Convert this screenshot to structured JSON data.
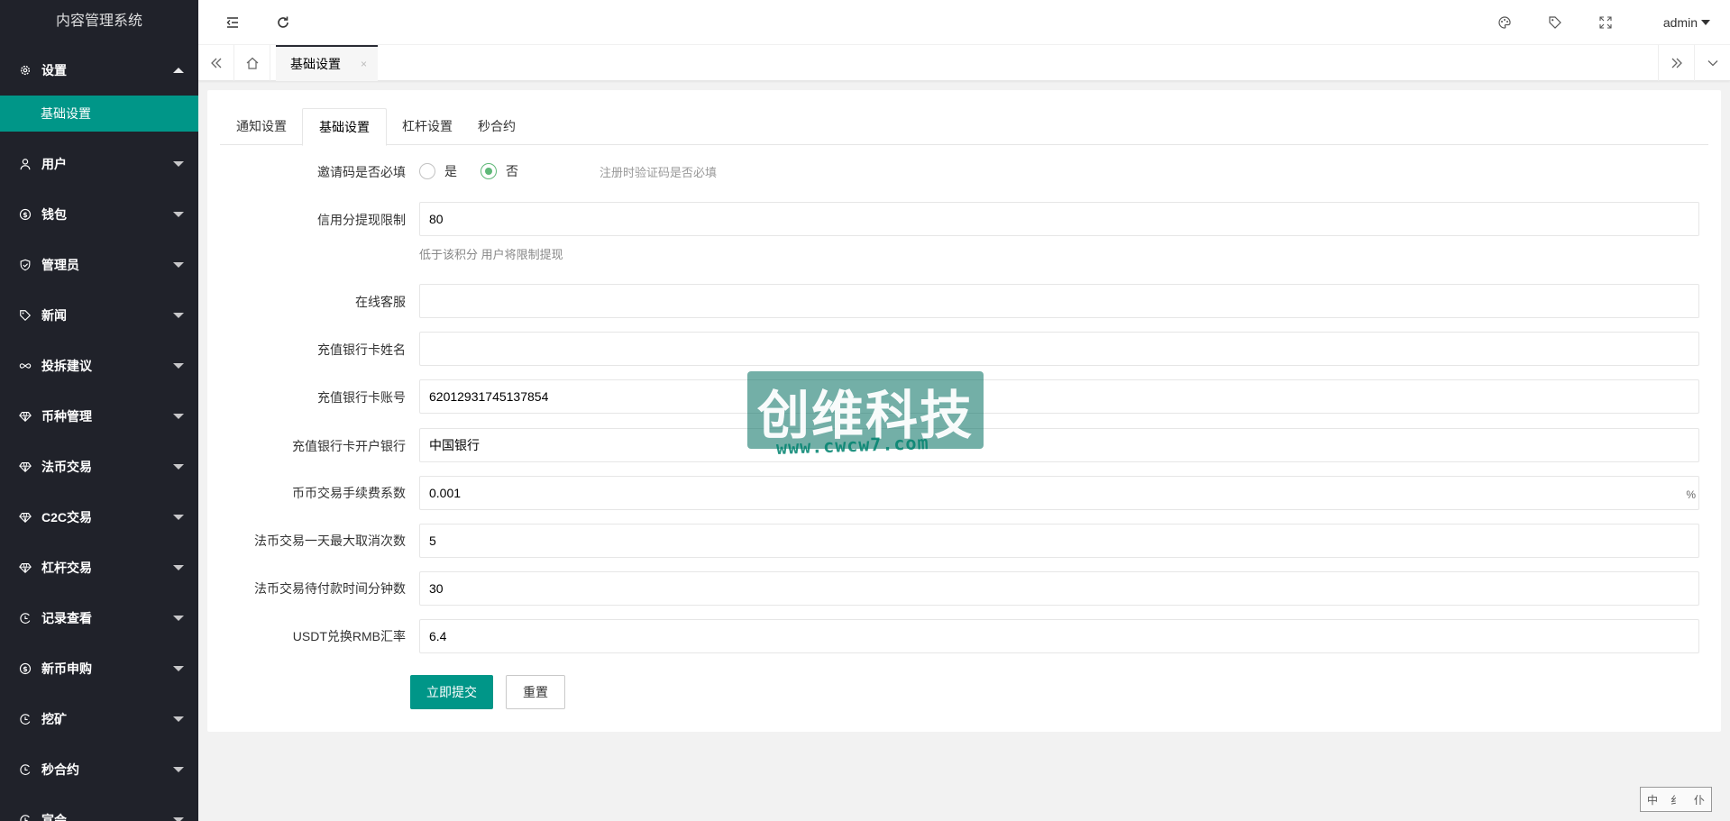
{
  "sidebar": {
    "title": "内容管理系统",
    "items": [
      {
        "label": "设置",
        "icon": "gear-icon",
        "expanded": true
      },
      {
        "label": "用户",
        "icon": "user-icon"
      },
      {
        "label": "钱包",
        "icon": "coin-icon"
      },
      {
        "label": "管理员",
        "icon": "shield-icon"
      },
      {
        "label": "新闻",
        "icon": "tag-icon"
      },
      {
        "label": "投拆建议",
        "icon": "infinity-icon"
      },
      {
        "label": "币种管理",
        "icon": "diamond-icon"
      },
      {
        "label": "法币交易",
        "icon": "diamond-icon"
      },
      {
        "label": "C2C交易",
        "icon": "diamond-icon"
      },
      {
        "label": "杠杆交易",
        "icon": "diamond-icon"
      },
      {
        "label": "记录查看",
        "icon": "clock-icon"
      },
      {
        "label": "新币申购",
        "icon": "coin-icon"
      },
      {
        "label": "挖矿",
        "icon": "clock-icon"
      },
      {
        "label": "秒合约",
        "icon": "clock-icon"
      },
      {
        "label": "宣会",
        "icon": "clock-icon"
      }
    ],
    "sub_items": [
      {
        "label": "基础设置",
        "active": true
      }
    ]
  },
  "header": {
    "user": "admin",
    "icons": [
      "menu-fold-icon",
      "refresh-icon",
      "theme-icon",
      "tag-icon",
      "fullscreen-icon"
    ]
  },
  "tabsbar": {
    "current_tab": "基础设置",
    "close": "×"
  },
  "form": {
    "tabs": [
      "通知设置",
      "基础设置",
      "杠杆设置",
      "秒合约"
    ],
    "active_tab": 1,
    "invite_required": {
      "label": "邀请码是否必填",
      "options": [
        "是",
        "否"
      ],
      "selected": "否",
      "hint": "注册时验证码是否必填"
    },
    "fields": [
      {
        "label": "信用分提现限制",
        "value": "80",
        "hint": "低于该积分 用户将限制提现"
      },
      {
        "label": "在线客服",
        "value": ""
      },
      {
        "label": "充值银行卡姓名",
        "value": ""
      },
      {
        "label": "充值银行卡账号",
        "value": "62012931745137854"
      },
      {
        "label": "充值银行卡开户银行",
        "value": "中国银行"
      },
      {
        "label": "币币交易手续费系数",
        "value": "0.001",
        "suffix": "%"
      },
      {
        "label": "法币交易一天最大取消次数",
        "value": "5"
      },
      {
        "label": "法币交易待付款时间分钟数",
        "value": "30"
      },
      {
        "label": "USDT兑换RMB汇率",
        "value": "6.4"
      }
    ],
    "submit_label": "立即提交",
    "reset_label": "重置"
  },
  "watermark": {
    "text": "创维科技",
    "url": "www.cwcw7.com"
  },
  "stamp": [
    "中",
    "纟",
    "仆"
  ],
  "colors": {
    "sidebar_bg": "#20222a",
    "accent": "#009688",
    "radio_checked": "#5fb878"
  }
}
